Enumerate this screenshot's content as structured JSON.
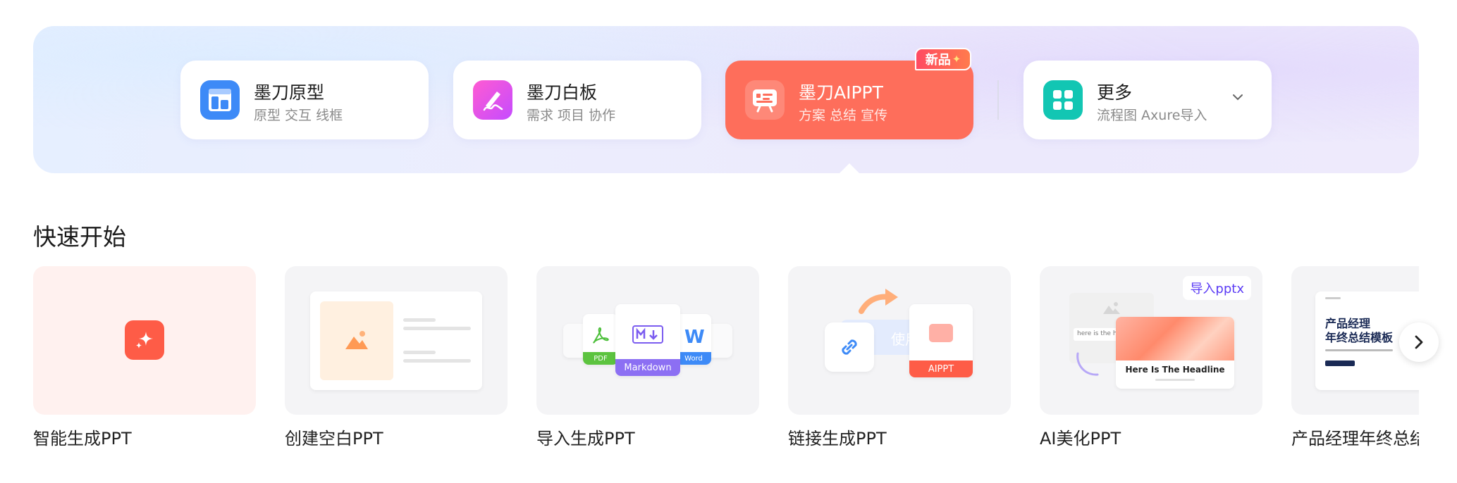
{
  "products": [
    {
      "title": "墨刀原型",
      "subtitle": "原型 交互 线框",
      "icon": "prototype-icon",
      "color": "#3d8af7"
    },
    {
      "title": "墨刀白板",
      "subtitle": "需求 项目 协作",
      "icon": "whiteboard-icon",
      "color": "#e14de8"
    },
    {
      "title": "墨刀AIPPT",
      "subtitle": "方案 总结 宣传",
      "icon": "presentation-icon",
      "color": "#fe6e5b",
      "badge": "新品"
    },
    {
      "title": "更多",
      "subtitle": "流程图 Axure导入",
      "icon": "grid-icon",
      "color": "#12c6b3"
    }
  ],
  "quick_start": {
    "title": "快速开始",
    "items": [
      {
        "label": "智能生成PPT"
      },
      {
        "label": "创建空白PPT"
      },
      {
        "label": "导入生成PPT",
        "tags": [
          "PDF",
          "Markdown",
          "Word"
        ]
      },
      {
        "label": "链接生成PPT",
        "overlay_text": "使用",
        "tag": "AIPPT"
      },
      {
        "label": "AI美化PPT",
        "tag": "导入pptx",
        "headline": "Here Is The Headline",
        "hint": "here is the he"
      },
      {
        "label": "产品经理年终总结模板",
        "thumb_title_line1": "产品经理",
        "thumb_title_line2": "年终总结模板"
      }
    ]
  },
  "colors": {
    "accent": "#fe6e5b",
    "badge": "#ff4a62"
  }
}
